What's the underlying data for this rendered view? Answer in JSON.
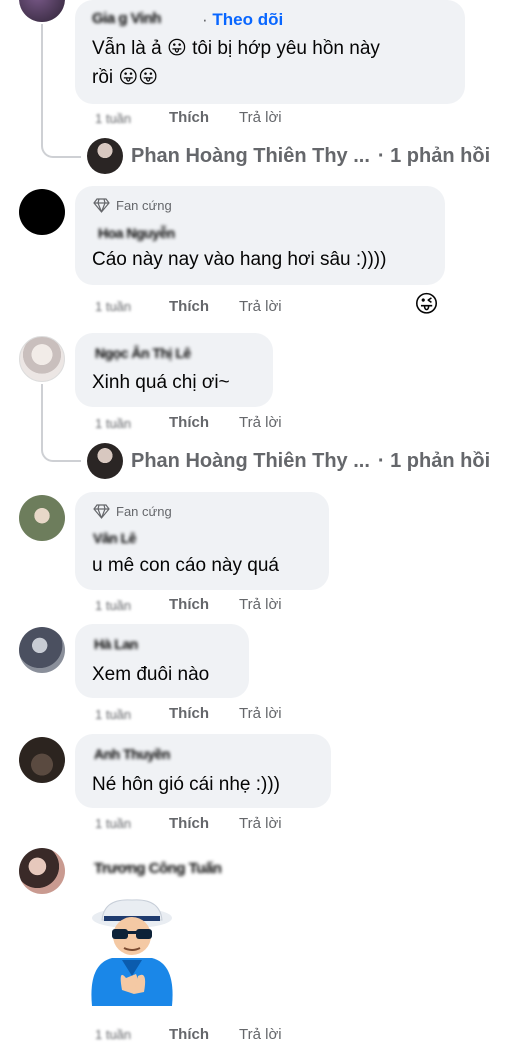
{
  "comments": [
    {
      "author": "Gia g Vinh",
      "follow_label": "Theo dõi",
      "text_line1": "Vẫn là ả 😛 tôi bị hớp yêu hồn này",
      "text_line2": "rồi 😛😛",
      "time": "1 tuần",
      "like": "Thích",
      "reply": "Trả lời",
      "replies": {
        "name": "Phan Hoàng Thiên Thy ...",
        "count": "· 1 phản hồi"
      }
    },
    {
      "badge": "Fan cứng",
      "author": "Hoa Nguyễn",
      "text": "Cáo này nay vào hang hơi sâu :))))",
      "time": "1 tuần",
      "like": "Thích",
      "reply": "Trả lời",
      "reaction": "😜"
    },
    {
      "author": "Ngọc Ân Thị Lê",
      "text": "Xinh quá chị ơi~",
      "time": "1 tuần",
      "like": "Thích",
      "reply": "Trả lời",
      "replies": {
        "name": "Phan Hoàng Thiên Thy ...",
        "count": "· 1 phản hồi"
      }
    },
    {
      "badge": "Fan cứng",
      "author": "Vân Lê",
      "text": "u mê con cáo này quá",
      "time": "1 tuần",
      "like": "Thích",
      "reply": "Trả lời"
    },
    {
      "author": "Hà Lan",
      "text": "Xem đuôi nào",
      "time": "1 tuần",
      "like": "Thích",
      "reply": "Trả lời"
    },
    {
      "author": "Anh Thuyền",
      "text": "Né hôn gió cái nhẹ :)))",
      "time": "1 tuần",
      "like": "Thích",
      "reply": "Trả lời"
    },
    {
      "author": "Trương Công Tuấn",
      "sticker": "old-man-clapping-sticker",
      "time": "1 tuần",
      "like": "Thích",
      "reply": "Trả lời"
    }
  ],
  "colors": {
    "bubble": "#f0f2f5",
    "secondary_text": "#65676b",
    "link": "#0866ff",
    "thread_line": "#ced0d4"
  }
}
